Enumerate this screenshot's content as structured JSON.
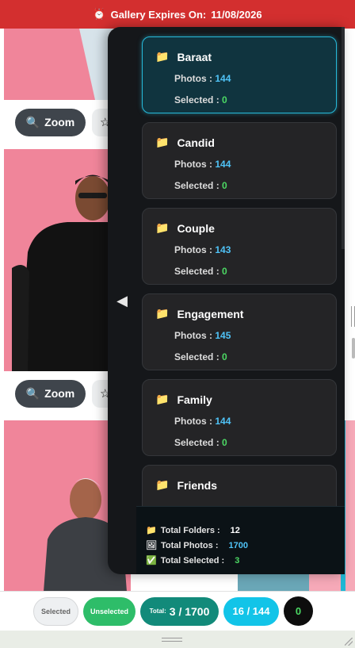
{
  "banner": {
    "icon": "alarm-clock-icon",
    "label": "Gallery Expires On:",
    "date": "11/08/2026"
  },
  "gallery": {
    "zoom_label": "Zoom",
    "zoom_icon": "magnifier-icon",
    "star_icon": "star-icon"
  },
  "panel": {
    "toggle_icon": "collapse-left-arrow-icon",
    "photos_label": "Photos :",
    "selected_label": "Selected :",
    "folders": [
      {
        "name": "Baraat",
        "photos": "144",
        "selected": "0",
        "active": true
      },
      {
        "name": "Candid",
        "photos": "144",
        "selected": "0"
      },
      {
        "name": "Couple",
        "photos": "143",
        "selected": "0"
      },
      {
        "name": "Engagement",
        "photos": "145",
        "selected": "0"
      },
      {
        "name": "Family",
        "photos": "144",
        "selected": "0"
      },
      {
        "name": "Friends",
        "photos": "",
        "selected": ""
      }
    ],
    "summary": {
      "folders_label": "Total Folders :",
      "folders_value": "12",
      "photos_label": "Total Photos :",
      "photos_value": "1700",
      "selected_label": "Total Selected :",
      "selected_value": "3"
    }
  },
  "bottom": {
    "selected_label": "Selected",
    "unselected_label": "Unselected",
    "total_label": "Total:",
    "total_value": "3 / 1700",
    "folder_count": "16 / 144",
    "zero_value": "0"
  },
  "colors": {
    "banner": "#d32f2f",
    "accent_cyan": "#12c4e8",
    "green": "#2ebd69",
    "teal": "#128a7a"
  }
}
